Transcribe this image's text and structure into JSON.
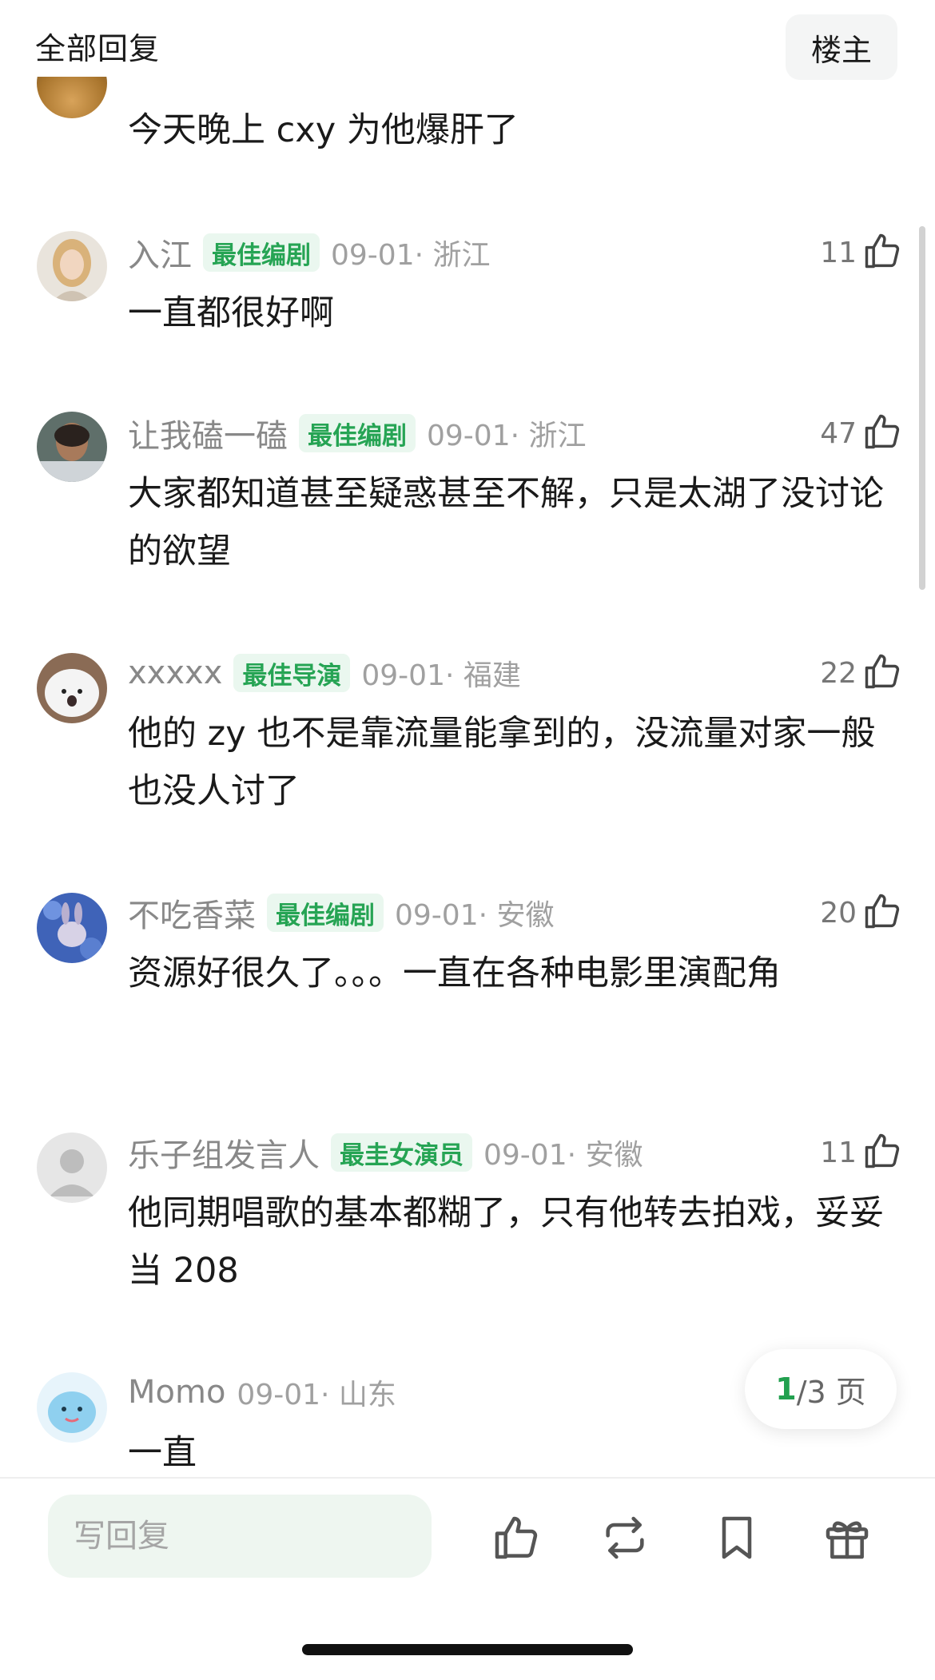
{
  "header": {
    "title": "全部回复",
    "owner_button": "楼主"
  },
  "top_comment_text": "今天晚上 cxy 为他爆肝了",
  "comments": [
    {
      "username": "入江",
      "badge": "最佳编剧",
      "date_location": "09-01· 浙江",
      "likes": "11",
      "text": "一直都很好啊"
    },
    {
      "username": "让我磕一磕",
      "badge": "最佳编剧",
      "date_location": "09-01· 浙江",
      "likes": "47",
      "text": "大家都知道甚至疑惑甚至不解，只是太湖了没讨论的欲望"
    },
    {
      "username": "xxxxx",
      "badge": "最佳导演",
      "date_location": "09-01· 福建",
      "likes": "22",
      "text": "他的 zy 也不是靠流量能拿到的，没流量对家一般也没人讨了"
    },
    {
      "username": "不吃香菜",
      "badge": "最佳编剧",
      "date_location": "09-01· 安徽",
      "likes": "20",
      "text": "资源好很久了。。。一直在各种电影里演配角"
    },
    {
      "username": "乐子组发言人",
      "badge": "最圭女演员",
      "date_location": "09-01· 安徽",
      "likes": "11",
      "text": "他同期唱歌的基本都糊了，只有他转去拍戏，妥妥当 208"
    },
    {
      "username": "Momo",
      "badge": "",
      "date_location": "09-01· 山东",
      "likes": "",
      "text": "一直"
    }
  ],
  "pager": {
    "current": "1",
    "total_label": "/3 页"
  },
  "bottom_bar": {
    "reply_placeholder": "写回复"
  },
  "colors": {
    "badge_green": "#26a454",
    "badge_bg": "#eaf7ef",
    "accent_green": "#22a04f"
  },
  "icons": {
    "like": "thumbs-up-icon",
    "repost": "repost-icon",
    "bookmark": "bookmark-icon",
    "gift": "gift-icon"
  }
}
